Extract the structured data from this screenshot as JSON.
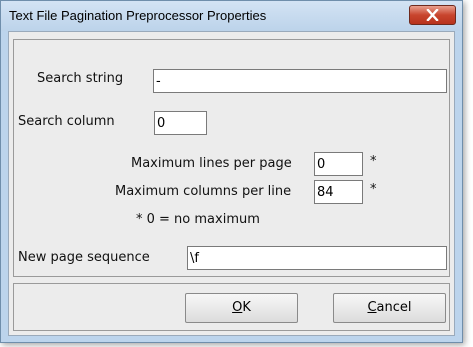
{
  "window": {
    "title": "Text File Pagination Preprocessor Properties"
  },
  "form": {
    "search_string": {
      "label": "Search string",
      "value": "-"
    },
    "search_column": {
      "label": "Search column",
      "value": "0"
    },
    "max_lines": {
      "label": "Maximum lines per page",
      "value": "0",
      "asterisk": "*"
    },
    "max_columns": {
      "label": "Maximum columns per line",
      "value": "84",
      "asterisk": "*"
    },
    "note": "* 0 = no maximum",
    "new_page_sequence": {
      "label": "New page sequence",
      "value": "\\f"
    }
  },
  "buttons": {
    "ok": {
      "mnemonic": "O",
      "rest": "K"
    },
    "cancel": {
      "mnemonic": "C",
      "rest": "ancel"
    }
  },
  "icons": {
    "close": "close-icon"
  },
  "colors": {
    "close_button": "#c8452e",
    "title_bar": "#c9dcef"
  }
}
